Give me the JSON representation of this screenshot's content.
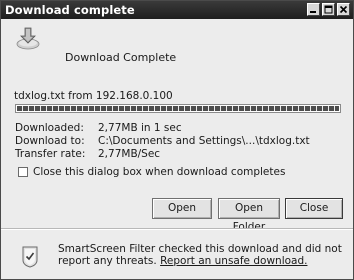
{
  "window": {
    "title": "Download complete",
    "header_label": "Download Complete",
    "title_buttons": [
      "minimize",
      "maximize",
      "close"
    ]
  },
  "download": {
    "from_line": "tdxlog.txt from 192.168.0.100",
    "progress_fraction": 1.0,
    "rows": [
      {
        "label": "Downloaded:",
        "value": "2,77MB in 1 sec"
      },
      {
        "label": "Download to:",
        "value": "C:\\Documents and Settings\\...\\tdxlog.txt"
      },
      {
        "label": "Transfer rate:",
        "value": "2,77MB/Sec"
      }
    ],
    "close_when_done_label": "Close this dialog box when download completes",
    "close_when_done_checked": false
  },
  "buttons": {
    "open": "Open",
    "open_folder": "Open Folder",
    "close": "Close"
  },
  "smartscreen": {
    "text": "SmartScreen Filter checked this download and did not report any threats.",
    "link": "Report an unsafe download."
  },
  "icons": {
    "header": "download-complete-icon",
    "smartscreen": "smartscreen-icon"
  }
}
